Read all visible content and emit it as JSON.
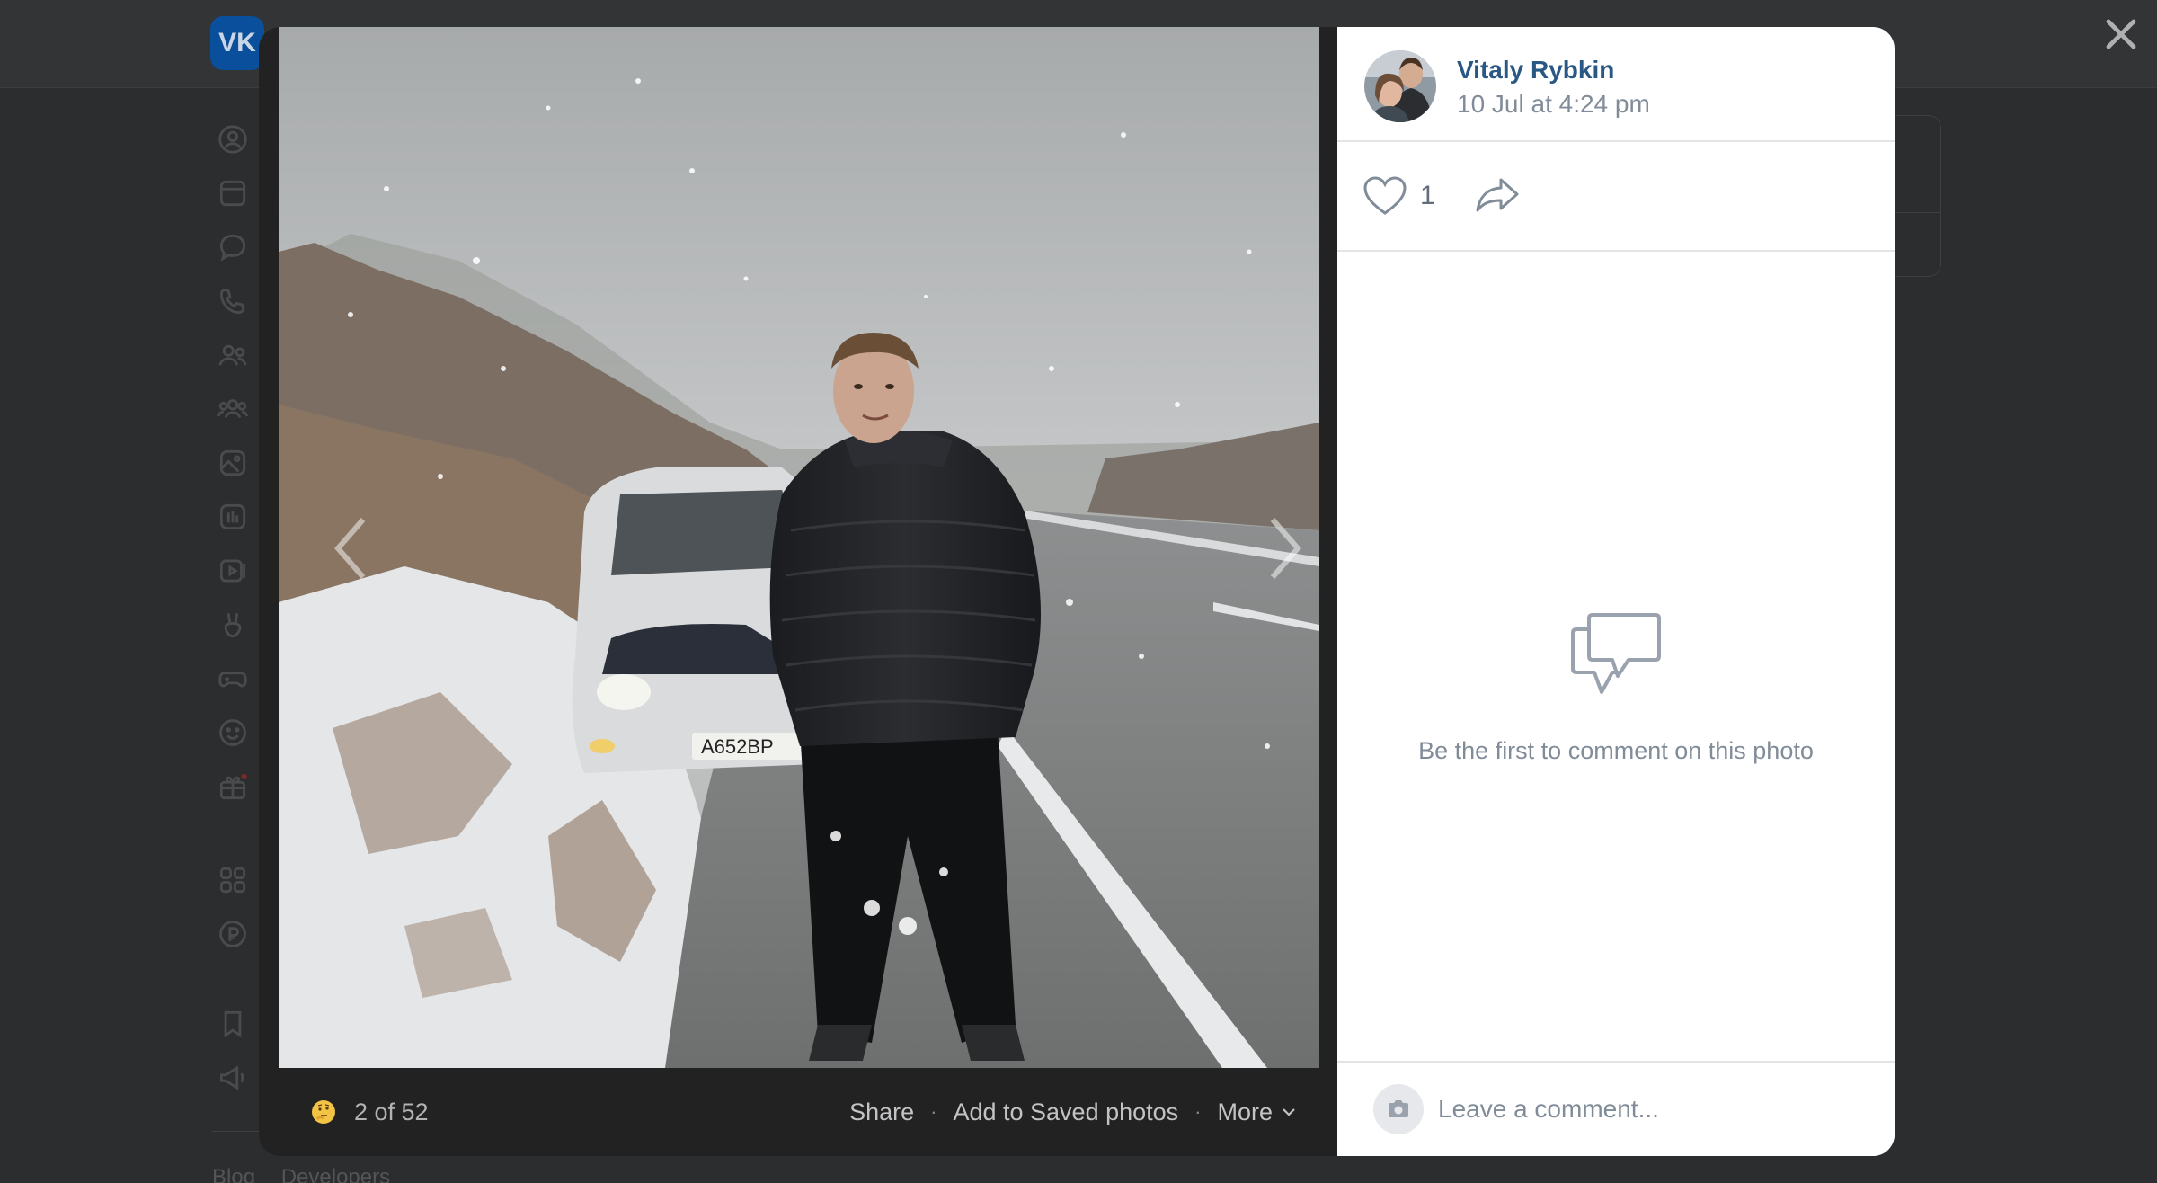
{
  "background": {
    "logo_text": "VK",
    "sidebar_icons": [
      "profile-icon",
      "news-icon",
      "messages-icon",
      "calls-icon",
      "friends-icon",
      "communities-icon",
      "photos-icon",
      "music-icon",
      "videos-icon",
      "clips-icon",
      "games-icon",
      "stickers-icon",
      "gifts-icon",
      "mini-apps-icon",
      "payments-icon",
      "bookmarks-icon",
      "ads-icon"
    ],
    "footer_links": [
      "Blog",
      "Developers"
    ]
  },
  "viewer": {
    "counter": "2 of 52",
    "reaction_emoji": "thinking-face-icon",
    "actions": {
      "share": "Share",
      "save": "Add to Saved photos",
      "more": "More"
    }
  },
  "author": {
    "name": "Vitaly Rybkin",
    "date": "10 Jul at 4:24 pm"
  },
  "likes": {
    "count": "1"
  },
  "comments": {
    "empty_text": "Be the first to comment on this photo",
    "placeholder": "Leave a comment..."
  },
  "photo": {
    "license_plate": "A652BP"
  },
  "colors": {
    "link": "#2a5885",
    "secondary_text": "#818c99",
    "overlay": "#2c2d2e",
    "vk_blue": "#0077ff"
  }
}
